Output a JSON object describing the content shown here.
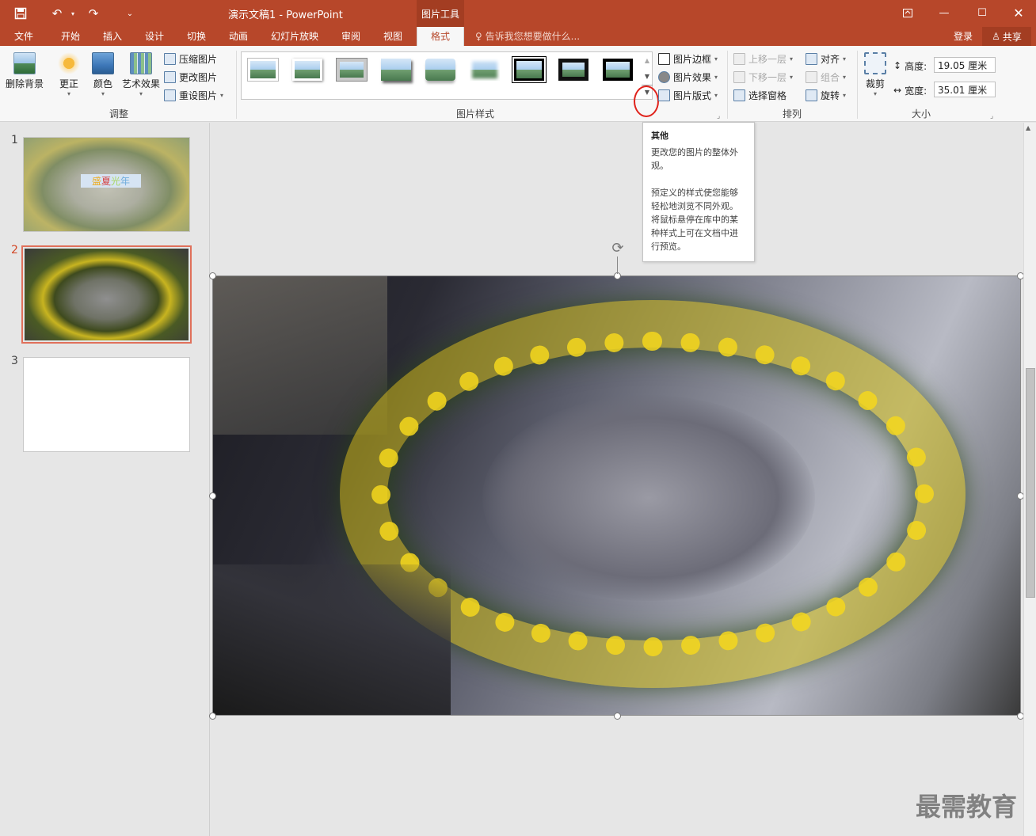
{
  "window": {
    "title": "演示文稿1 - PowerPoint",
    "contextual_tab": "图片工具"
  },
  "tabs": [
    {
      "label": "文件"
    },
    {
      "label": "开始"
    },
    {
      "label": "插入"
    },
    {
      "label": "设计"
    },
    {
      "label": "切换"
    },
    {
      "label": "动画"
    },
    {
      "label": "幻灯片放映"
    },
    {
      "label": "审阅"
    },
    {
      "label": "视图"
    },
    {
      "label": "格式"
    }
  ],
  "tell_me": "告诉我您想要做什么...",
  "account": {
    "login": "登录",
    "share": "共享"
  },
  "ribbon": {
    "adjust": {
      "remove_bg": "删除背景",
      "corrections": "更正",
      "color": "颜色",
      "artistic": "艺术效果",
      "compress": "压缩图片",
      "change": "更改图片",
      "reset": "重设图片",
      "label": "调整"
    },
    "styles": {
      "label": "图片样式",
      "border": "图片边框",
      "effects": "图片效果",
      "layout": "图片版式"
    },
    "arrange": {
      "forward": "上移一层",
      "backward": "下移一层",
      "selection_pane": "选择窗格",
      "align": "对齐",
      "group": "组合",
      "rotate": "旋转",
      "label": "排列"
    },
    "size": {
      "crop": "裁剪",
      "height_label": "高度:",
      "height_value": "19.05 厘米",
      "width_label": "宽度:",
      "width_value": "35.01 厘米",
      "label": "大小"
    }
  },
  "slides": [
    {
      "number": "1",
      "title_text_1": "盛",
      "title_text_2": "夏",
      "title_text_3": "光",
      "title_text_4": "年"
    },
    {
      "number": "2"
    },
    {
      "number": "3"
    }
  ],
  "tooltip": {
    "title": "其他",
    "line1": "更改您的图片的整体外观。",
    "line2": "预定义的样式使您能够轻松地浏览不同外观。将鼠标悬停在库中的某种样式上可在文档中进行预览。"
  },
  "watermark": "最需教育",
  "colors": {
    "accent": "#b7472a",
    "selected_slide_border": "#e0705b",
    "highlight_circle": "#e0221b"
  }
}
